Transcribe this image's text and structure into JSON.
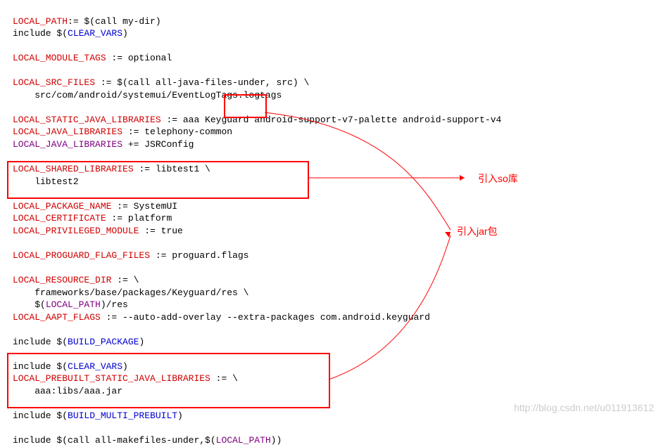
{
  "lines": {
    "l1a": "LOCAL_PATH",
    "l1b": ":= $(call my-dir)",
    "l2a": "include $(",
    "l2b": "CLEAR_VARS",
    "l2c": ")",
    "l3a": "LOCAL_MODULE_TAGS",
    "l3b": " := optional",
    "l4a": "LOCAL_SRC_FILES",
    "l4b": " := $(call all-java-files-under, src) \\",
    "l5": "    src/com/android/systemui/EventLogTags.logtags",
    "l6a": "LOCAL_STATIC_JAVA_LIBRARIES",
    "l6b": " := aaa Keyguard android-support-v7-palette android-support-v4",
    "l7a": "LOCAL_JAVA_LIBRARIES",
    "l7b": " := telephony-common",
    "l8a": "LOCAL_JAVA_LIBRARIES",
    "l8b": " += JSRConfig",
    "l9a": "LOCAL_SHARED_LIBRARIES",
    "l9b": " := libtest1 \\",
    "l10": "    libtest2",
    "l11a": "LOCAL_PACKAGE_NAME",
    "l11b": " := SystemUI",
    "l12a": "LOCAL_CERTIFICATE",
    "l12b": " := platform",
    "l13a": "LOCAL_PRIVILEGED_MODULE",
    "l13b": " := true",
    "l14a": "LOCAL_PROGUARD_FLAG_FILES",
    "l14b": " := proguard.flags",
    "l15a": "LOCAL_RESOURCE_DIR",
    "l15b": " := \\",
    "l16": "    frameworks/base/packages/Keyguard/res \\",
    "l17a": "    $(",
    "l17b": "LOCAL_PATH",
    "l17c": ")/res",
    "l18a": "LOCAL_AAPT_FLAGS",
    "l18b": " := --auto-add-overlay --extra-packages com.android.keyguard",
    "l19a": "include $(",
    "l19b": "BUILD_PACKAGE",
    "l19c": ")",
    "l20a": "include $(",
    "l20b": "CLEAR_VARS",
    "l20c": ")",
    "l21a": "LOCAL_PREBUILT_STATIC_JAVA_LIBRARIES",
    "l21b": " := \\",
    "l22": "    aaa:libs/aaa.jar",
    "l23a": "include $(",
    "l23b": "BUILD_MULTI_PREBUILT",
    "l23c": ")",
    "l24a": "include $(call all-makefiles-under,$(",
    "l24b": "LOCAL_PATH",
    "l24c": "))"
  },
  "annotations": {
    "so": "引入so库",
    "jar": "引入jar包"
  },
  "watermark": "http://blog.csdn.net/u011913612"
}
